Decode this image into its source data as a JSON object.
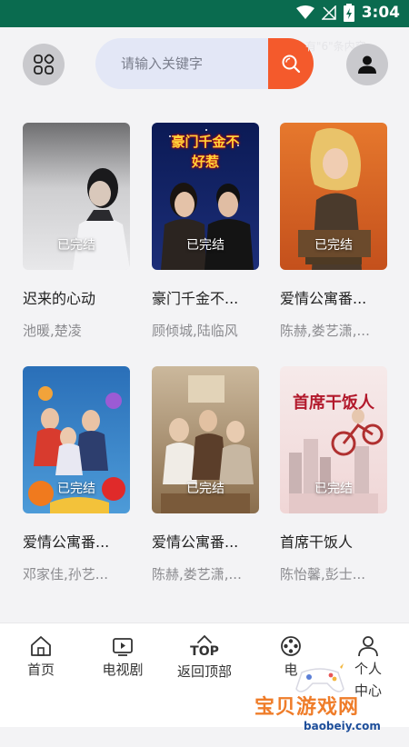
{
  "status": {
    "time": "3:04"
  },
  "search": {
    "placeholder": "请输入关键字",
    "hint": "有\"6\"条内容"
  },
  "dramas": [
    {
      "title": "迟来的心动",
      "cast": "池暖,楚凌",
      "badge": "已完结"
    },
    {
      "title": "豪门千金不...",
      "cast": "顾倾城,陆临风",
      "badge": "已完结",
      "poster_text": "豪门千金不好惹"
    },
    {
      "title": "爱情公寓番...",
      "cast": "陈赫,娄艺潇,...",
      "badge": "已完结"
    },
    {
      "title": "爱情公寓番...",
      "cast": "邓家佳,孙艺...",
      "badge": "已完结"
    },
    {
      "title": "爱情公寓番...",
      "cast": "陈赫,娄艺潇,...",
      "badge": "已完结"
    },
    {
      "title": "首席干饭人",
      "cast": "陈怡馨,彭士...",
      "badge": "已完结",
      "poster_text": "首席干饭人"
    }
  ],
  "nav": {
    "home": "首页",
    "tv": "电视剧",
    "top_label": "TOP",
    "back_top": "返回顶部",
    "movie": "电",
    "user_center": "个人中心"
  },
  "watermark": {
    "text": "宝贝游戏网",
    "url": "baobeiy.com"
  },
  "colors": {
    "status_bar": "#0a6b4f",
    "search_button": "#f45a2c",
    "search_bg": "#e3e7f6",
    "icon_circle": "#c9c9cd"
  }
}
